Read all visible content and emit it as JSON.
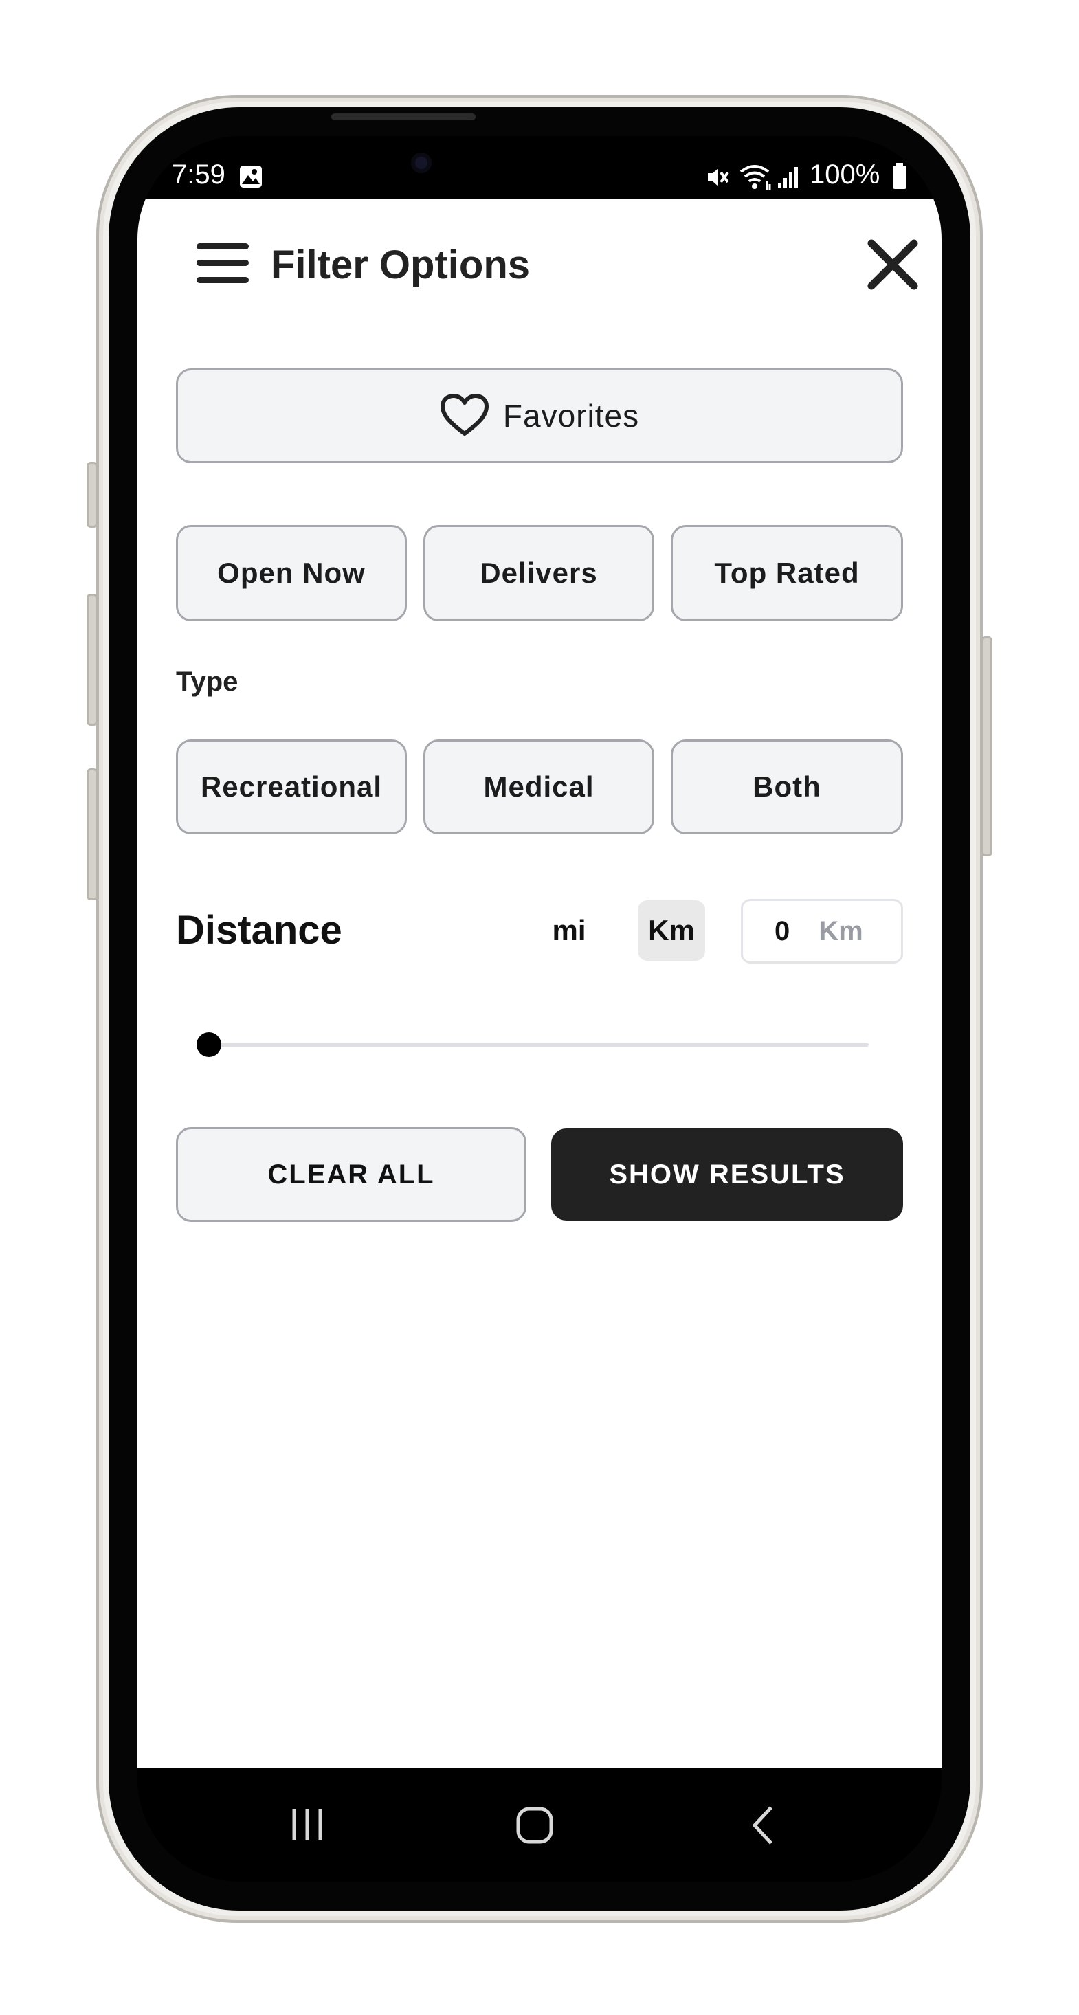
{
  "status_bar": {
    "time": "7:59",
    "battery": "100%",
    "icons": [
      "gallery-icon",
      "mute-icon",
      "wifi-icon",
      "signal-icon",
      "battery-icon"
    ]
  },
  "header": {
    "title": "Filter Options",
    "menu_icon": "hamburger-menu-icon",
    "close_icon": "close-icon"
  },
  "favorites": {
    "label": "Favorites",
    "icon": "heart-icon"
  },
  "quick_filters": [
    "Open Now",
    "Delivers",
    "Top Rated"
  ],
  "type_section": {
    "label": "Type",
    "options": [
      "Recreational",
      "Medical",
      "Both"
    ]
  },
  "distance": {
    "label": "Distance",
    "units": [
      "mi",
      "Km"
    ],
    "selected_unit": "Km",
    "value": "0",
    "value_unit": "Km",
    "slider_value": 0
  },
  "actions": {
    "clear": "CLEAR ALL",
    "show": "SHOW RESULTS"
  },
  "nav_bar": [
    "recent-apps-icon",
    "home-icon",
    "back-icon"
  ],
  "colors": {
    "dark_button": "#222222",
    "light_button": "#f3f4f6",
    "border": "#a5a7ad"
  }
}
